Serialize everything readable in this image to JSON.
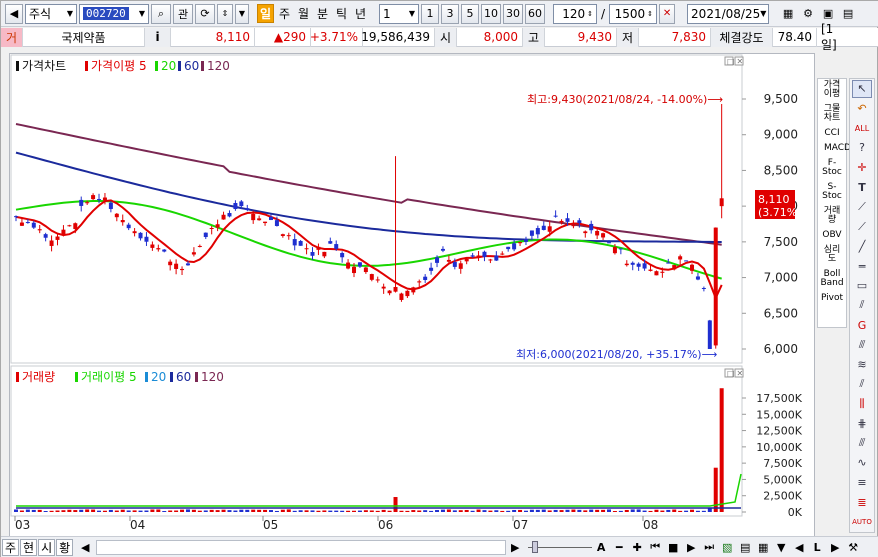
{
  "toolbar": {
    "market": "주식",
    "code": "002720",
    "kwan_btn": "관",
    "periods": [
      "일",
      "주",
      "월",
      "분",
      "틱",
      "년"
    ],
    "active_period": "일",
    "interval_value": "1",
    "quick_intervals": [
      "1",
      "3",
      "5",
      "10",
      "30",
      "60"
    ],
    "count_value": "120",
    "separator": "/",
    "total_value": "1500",
    "date_value": "2021/08/25"
  },
  "quote": {
    "flag": "거",
    "name": "국제약품",
    "info": "i",
    "price": "8,110",
    "change": "▲290",
    "change_pct": "+3.71%",
    "volume": "19,586,439",
    "open_label": "시",
    "open": "8,000",
    "high_label": "고",
    "high": "9,430",
    "low_label": "저",
    "low": "7,830",
    "strength_label": "체결강도",
    "strength": "78.40",
    "period_badge": "[1일]"
  },
  "price_panel": {
    "legend_items": [
      "가격차트",
      "가격이평 5",
      "20",
      "60",
      "120"
    ],
    "max_label": "최고:9,430(2021/08/24, -14.00%)⟶",
    "min_label": "최저:6,000(2021/08/20, +35.17%)⟶",
    "last_price": "8,110",
    "last_pct": "(3.71%)",
    "yticks": [
      "9,500",
      "9,000",
      "8,500",
      "8,000",
      "7,500",
      "7,000",
      "6,500",
      "6,000"
    ]
  },
  "volume_panel": {
    "legend_items": [
      "거래량",
      "거래이평 5",
      "20",
      "60",
      "120"
    ],
    "yticks": [
      "17,500K",
      "15,000K",
      "12,500K",
      "10,000K",
      "7,500K",
      "5,000K",
      "2,500K",
      "0K"
    ]
  },
  "x_labels": [
    "03",
    "04",
    "05",
    "06",
    "07",
    "08"
  ],
  "indicators": [
    "가격이평",
    "그물차트",
    "CCI",
    "MACD",
    "F-Stoc",
    "S-Stoc",
    "거래량",
    "OBV",
    "심리도",
    "Boll Band",
    "Pivot"
  ],
  "bottom_tabs": [
    "주",
    "현",
    "시",
    "황"
  ],
  "colors": {
    "up": "#e00000",
    "down": "#1f2fd0",
    "ma5": "#e00000",
    "ma20": "#19d600",
    "ma60": "#1b2a9c",
    "ma120": "#7a2752"
  }
}
